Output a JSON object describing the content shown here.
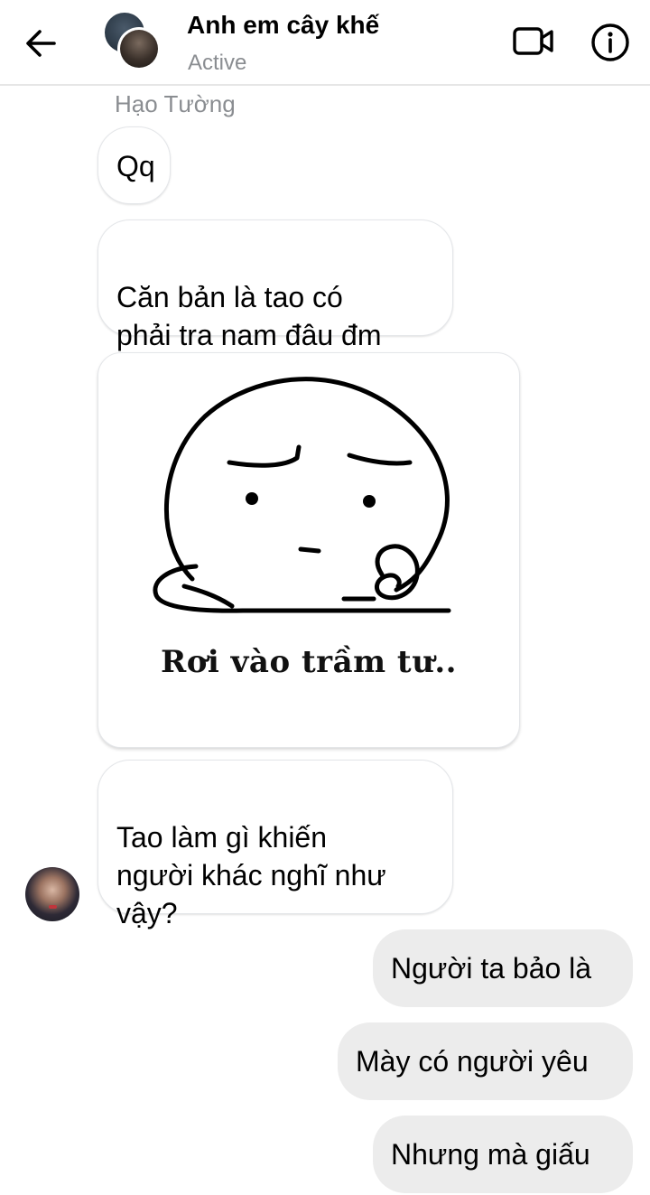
{
  "header": {
    "title": "Anh em cây khế",
    "status": "Active",
    "back_icon": "arrow-left-icon",
    "video_icon": "video-camera-icon",
    "info_icon": "info-icon"
  },
  "conversation": {
    "sender_name": "Hạo Tường",
    "incoming": [
      {
        "text": "Qq"
      },
      {
        "text": "Căn bản là tao có\nphải tra nam đâu đm"
      },
      {
        "sticker_caption": "Rơi vào trầm tư.."
      },
      {
        "text": "Tao làm gì khiến\nngười khác nghĩ như\nvậy?"
      }
    ],
    "outgoing": [
      {
        "text": "Người ta bảo là"
      },
      {
        "text": "Mày có người yêu"
      },
      {
        "text": "Nhưng mà giấu"
      }
    ]
  },
  "colors": {
    "outgoing_bubble": "#ececec",
    "incoming_bubble": "#ffffff",
    "secondary_text": "#8a8d91"
  }
}
